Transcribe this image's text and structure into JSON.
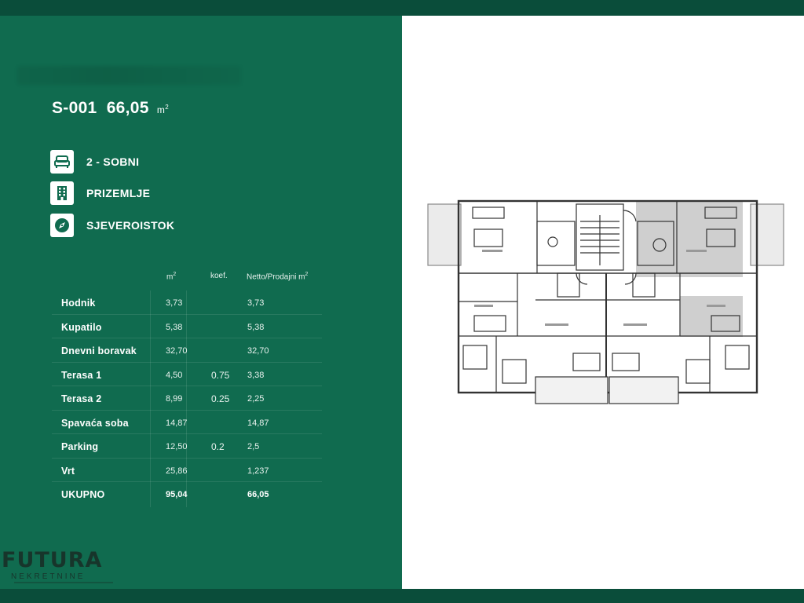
{
  "unit": {
    "code": "S-001",
    "area": "66,05",
    "unit_label": "m",
    "unit_sup": "2"
  },
  "info": [
    {
      "label": "2 - SOBNI",
      "icon": "bed-icon"
    },
    {
      "label": "PRIZEMLJE",
      "icon": "building-icon"
    },
    {
      "label": "SJEVEROISTOK",
      "icon": "compass-icon"
    }
  ],
  "table": {
    "headers": {
      "m2": "m",
      "m2_sup": "2",
      "koef": "koef.",
      "net": "Netto/Prodajni m",
      "net_sup": "2"
    },
    "rows": [
      {
        "name": "Hodnik",
        "m2": "3,73",
        "koef": "",
        "net": "3,73"
      },
      {
        "name": "Kupatilo",
        "m2": "5,38",
        "koef": "",
        "net": "5,38"
      },
      {
        "name": "Dnevni boravak",
        "m2": "32,70",
        "koef": "",
        "net": "32,70"
      },
      {
        "name": "Terasa 1",
        "m2": "4,50",
        "koef": "0.75",
        "net": "3,38"
      },
      {
        "name": "Terasa 2",
        "m2": "8,99",
        "koef": "0.25",
        "net": "2,25"
      },
      {
        "name": "Spavaća soba",
        "m2": "14,87",
        "koef": "",
        "net": "14,87"
      },
      {
        "name": "Parking",
        "m2": "12,50",
        "koef": "0.2",
        "net": "2,5"
      },
      {
        "name": "Vrt",
        "m2": "25,86",
        "koef": "",
        "net": "1,237"
      },
      {
        "name": "UKUPNO",
        "m2": "95,04",
        "koef": "",
        "net": "66,05"
      }
    ]
  },
  "logo": {
    "main": "FUTURA",
    "sub": "NEKRETNINE"
  },
  "colors": {
    "panel": "#106b4f",
    "band": "#0a4d3a",
    "plan_bg": "#ffffff",
    "highlight": "#c8c8c8"
  }
}
